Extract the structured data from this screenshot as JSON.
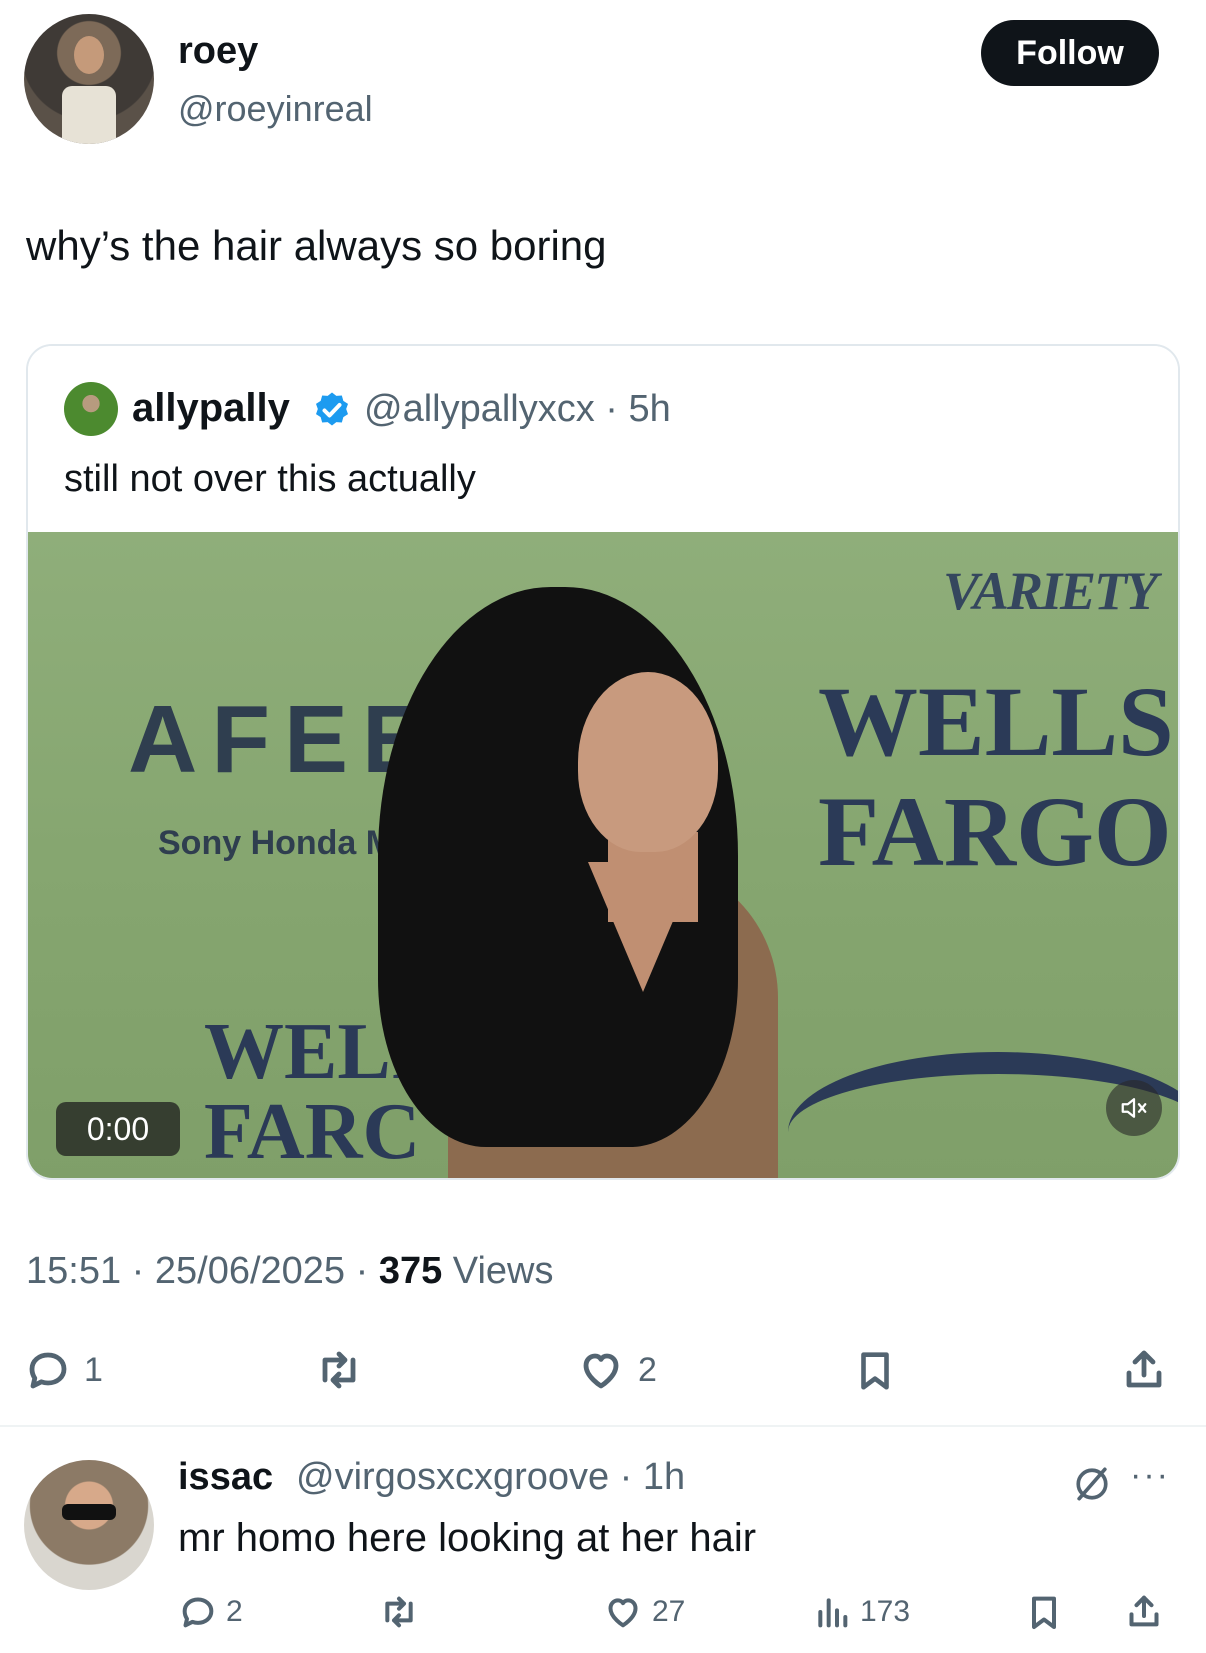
{
  "post": {
    "author_name": "roey",
    "author_handle": "@roeyinreal",
    "follow_label": "Follow",
    "text": "why’s the hair always so boring",
    "timestamp": "15:51 · 25/06/2025 · ",
    "views_count": "375",
    "views_label": " Views",
    "reply_count": "1",
    "like_count": "2"
  },
  "quote": {
    "author_name": "allypally",
    "author_handle": "@allypallyxcx · 5h",
    "text": "still not over this actually",
    "video_time": "0:00",
    "video_signage": {
      "variety": "VARIETY",
      "wells": "WELLS",
      "fargo": "FARGO",
      "afeela": "AFEEL",
      "sony": "Sony Honda Mobi",
      "wel_partial": "WELI",
      "far_partial": "FARC"
    }
  },
  "reply": {
    "author_name": "issac",
    "author_handle": "@virgosxcxgroove · 1h",
    "text": "mr homo here looking at her hair",
    "reply_count": "2",
    "like_count": "27",
    "views_count": "173",
    "more_label": "···"
  },
  "colors": {
    "text_primary": "#0f1419",
    "text_secondary": "#536471",
    "verified_blue": "#1d9bf0",
    "media_bg": "#86a670"
  }
}
